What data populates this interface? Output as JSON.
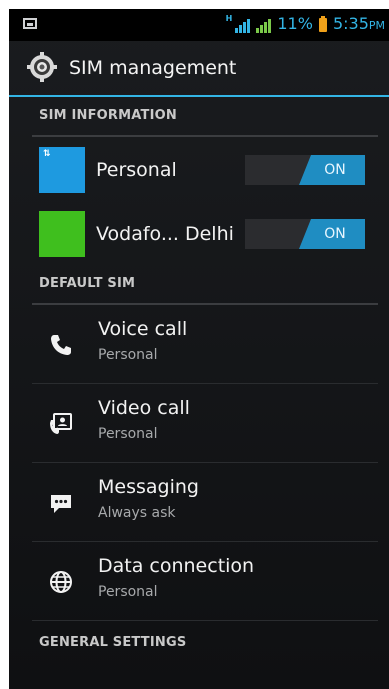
{
  "status_bar": {
    "network_badge": "H",
    "battery_percent": "11%",
    "time": "5:35",
    "ampm": "PM",
    "battery_color": "#f0a11a",
    "accent": "#33b5e5"
  },
  "action_bar": {
    "title": "SIM management",
    "icon": "settings-gear-icon"
  },
  "sections": {
    "sim_information": "SIM INFORMATION",
    "default_sim": "DEFAULT SIM",
    "general_settings": "GENERAL SETTINGS"
  },
  "sims": [
    {
      "label": "Personal",
      "color": "#1e9ae0",
      "toggle": "ON"
    },
    {
      "label": "Vodafo... Delhi",
      "color": "#3fbf1e",
      "toggle": "ON"
    }
  ],
  "default_sim_items": [
    {
      "title": "Voice call",
      "subtitle": "Personal",
      "icon": "phone-icon"
    },
    {
      "title": "Video call",
      "subtitle": "Personal",
      "icon": "video-call-icon"
    },
    {
      "title": "Messaging",
      "subtitle": "Always ask",
      "icon": "message-icon"
    },
    {
      "title": "Data connection",
      "subtitle": "Personal",
      "icon": "globe-icon"
    }
  ]
}
